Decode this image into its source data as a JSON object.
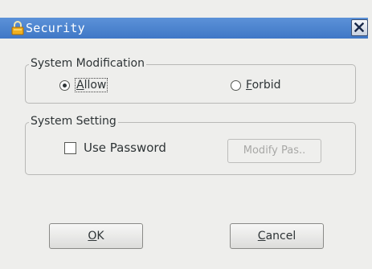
{
  "window": {
    "title": "Security",
    "icon": "lock-icon",
    "close_icon": "close-icon"
  },
  "groups": {
    "system_modification": {
      "title": "System Modification",
      "options": {
        "allow": {
          "mnemonic": "A",
          "rest": "llow",
          "selected": true
        },
        "forbid": {
          "mnemonic": "F",
          "rest": "orbid",
          "selected": false
        }
      }
    },
    "system_setting": {
      "title": "System Setting",
      "use_password": {
        "label": "Use Password",
        "checked": false
      },
      "modify_button": {
        "label": "Modify Pas..",
        "enabled": false
      }
    }
  },
  "buttons": {
    "ok": {
      "mnemonic": "O",
      "rest": "K"
    },
    "cancel": {
      "mnemonic": "C",
      "rest": "ancel"
    }
  },
  "colors": {
    "titlebar": "#4a84d0",
    "background": "#eeeeec",
    "text": "#2e3436"
  }
}
